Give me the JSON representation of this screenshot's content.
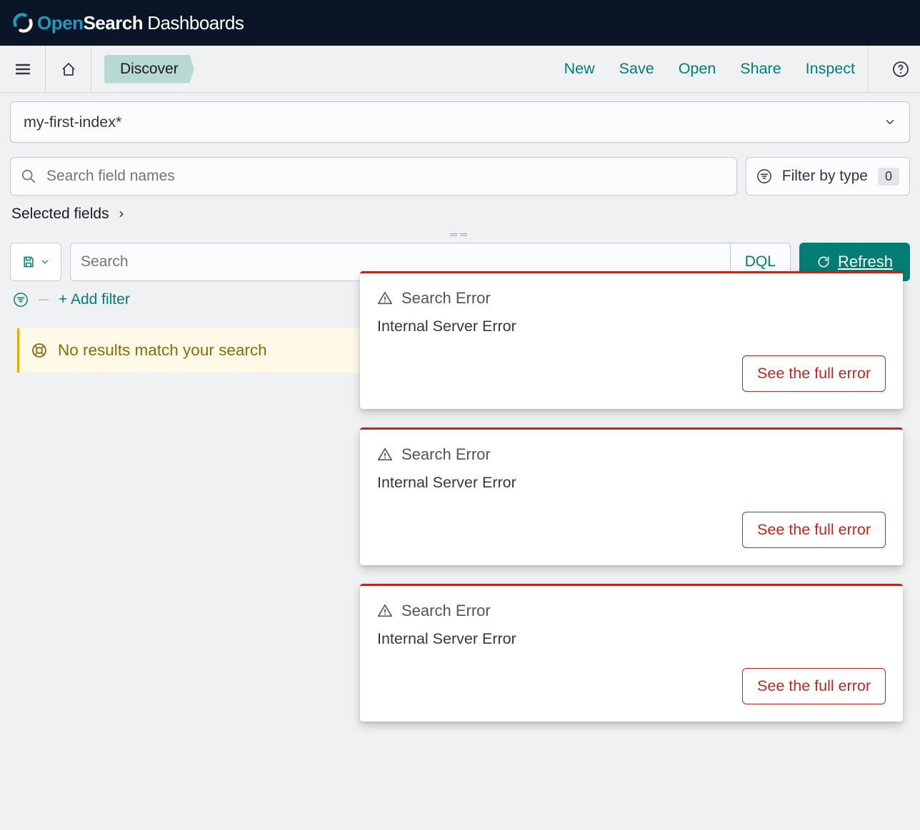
{
  "brand": {
    "open": "Open",
    "search": "Search",
    "dash": "Dashboards"
  },
  "tab": {
    "label": "Discover"
  },
  "nav": {
    "new": "New",
    "save": "Save",
    "open": "Open",
    "share": "Share",
    "inspect": "Inspect"
  },
  "index": {
    "selected": "my-first-index*"
  },
  "fields": {
    "search_placeholder": "Search field names",
    "filter_by_type": "Filter by type",
    "filter_count": "0",
    "selected_label": "Selected fields"
  },
  "query": {
    "placeholder": "Search",
    "dql": "DQL",
    "refresh": "Refresh"
  },
  "filter_bar": {
    "add": "+ Add filter"
  },
  "callout": {
    "text": "No results match your search"
  },
  "toasts": [
    {
      "title": "Search Error",
      "body": "Internal Server Error",
      "action": "See the full error"
    },
    {
      "title": "Search Error",
      "body": "Internal Server Error",
      "action": "See the full error"
    },
    {
      "title": "Search Error",
      "body": "Internal Server Error",
      "action": "See the full error"
    }
  ],
  "colors": {
    "accent": "#017d73",
    "danger": "#bd271e",
    "warning": "#f5a700"
  }
}
